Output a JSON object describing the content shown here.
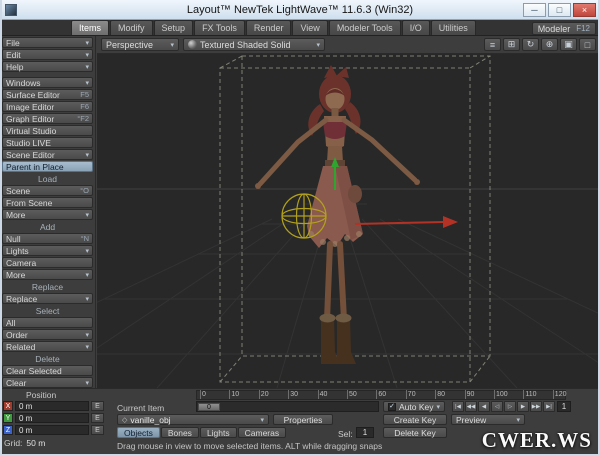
{
  "window": {
    "title": "Layout™ NewTek LightWave™ 11.6.3 (Win32)",
    "controls": [
      {
        "name": "minimize",
        "glyph": "─"
      },
      {
        "name": "maximize",
        "glyph": "□"
      },
      {
        "name": "close",
        "glyph": "×"
      }
    ]
  },
  "tabbar": {
    "tabs": [
      {
        "label": "Items",
        "active": true
      },
      {
        "label": "Modify"
      },
      {
        "label": "Setup"
      },
      {
        "label": "FX Tools"
      },
      {
        "label": "Render"
      },
      {
        "label": "View"
      },
      {
        "label": "Modeler Tools"
      },
      {
        "label": "I/O"
      },
      {
        "label": "Utilities"
      }
    ],
    "modeler_label": "Modeler",
    "modeler_hotkey": "F12"
  },
  "viewport_toolbar": {
    "view_mode": "Perspective",
    "shading_mode": "Textured Shaded Solid",
    "icons": [
      {
        "name": "menu-icon",
        "glyph": "≡"
      },
      {
        "name": "pan-icon",
        "glyph": "⊞"
      },
      {
        "name": "rotate-icon",
        "glyph": "↻"
      },
      {
        "name": "zoom-icon",
        "glyph": "⊕"
      },
      {
        "name": "fit-icon",
        "glyph": "▣"
      },
      {
        "name": "maximize-icon",
        "glyph": "□"
      }
    ]
  },
  "sidebar": {
    "items": [
      {
        "label": "File",
        "arrow": true
      },
      {
        "label": "Edit",
        "arrow": true
      },
      {
        "label": "Help",
        "arrow": true
      },
      {
        "type": "gap"
      },
      {
        "label": "Windows",
        "arrow": true
      },
      {
        "label": "Surface Editor",
        "hotkey": "F5"
      },
      {
        "label": "Image Editor",
        "hotkey": "F6"
      },
      {
        "label": "Graph Editor",
        "hotkey": "°F2"
      },
      {
        "label": "Virtual Studio"
      },
      {
        "label": "Studio LIVE"
      },
      {
        "label": "Scene Editor",
        "arrow": true
      },
      {
        "label": "Parent in Place",
        "active": true
      },
      {
        "type": "header",
        "label": "Load"
      },
      {
        "label": "Scene",
        "hotkey": "°O"
      },
      {
        "label": "From Scene"
      },
      {
        "label": "More",
        "arrow": true
      },
      {
        "type": "header",
        "label": "Add"
      },
      {
        "label": "Null",
        "hotkey": "°N"
      },
      {
        "label": "Lights",
        "arrow": true
      },
      {
        "label": "Camera"
      },
      {
        "label": "More",
        "arrow": true
      },
      {
        "type": "header",
        "label": "Replace"
      },
      {
        "label": "Replace",
        "arrow": true
      },
      {
        "type": "header",
        "label": "Select"
      },
      {
        "label": "All"
      },
      {
        "label": "Order",
        "arrow": true
      },
      {
        "label": "Related",
        "arrow": true
      },
      {
        "type": "header",
        "label": "Delete"
      },
      {
        "label": "Clear Selected"
      },
      {
        "label": "Clear",
        "arrow": true
      }
    ]
  },
  "viewport": {
    "selected_object": "vanille_obj",
    "axis_colors": {
      "x": "#b43225",
      "y": "#2fa52f",
      "z": "#3a62c8"
    },
    "wireframe_sphere_color": "#b2a11b",
    "bounding_box_color": "#98988a",
    "background_color": "#282828"
  },
  "bottom": {
    "position_label": "Position",
    "axes": [
      {
        "label": "X",
        "value": "0 m",
        "color": "#a03c2e"
      },
      {
        "label": "Y",
        "value": "0 m",
        "color": "#3f9a3f"
      },
      {
        "label": "Z",
        "value": "0 m",
        "color": "#3a62c8"
      }
    ],
    "envelope_label": "E",
    "grid_label": "Grid:",
    "grid_value": "50 m",
    "current_item_label": "Current Item",
    "current_item_icon": "◇",
    "current_item_value": "vanille_obj",
    "properties_label": "Properties",
    "item_types": [
      {
        "label": "Objects",
        "active": true
      },
      {
        "label": "Bones"
      },
      {
        "label": "Lights"
      },
      {
        "label": "Cameras"
      }
    ],
    "sel_label": "Sel:",
    "sel_value": "1",
    "auto_key_label": "Auto Key",
    "auto_key_checked": true,
    "create_key_label": "Create Key",
    "delete_key_label": "Delete Key",
    "preview_label": "Preview",
    "timeline": {
      "start": 0,
      "end": 120,
      "step": 10,
      "current": "0"
    },
    "frame_step": "1",
    "transport": [
      {
        "name": "go-start-button",
        "glyph": "|◀"
      },
      {
        "name": "prev-key-button",
        "glyph": "◀◀"
      },
      {
        "name": "prev-frame-button",
        "glyph": "◀"
      },
      {
        "name": "play-reverse-button",
        "glyph": "◁"
      },
      {
        "name": "play-forward-button",
        "glyph": "▷"
      },
      {
        "name": "next-frame-button",
        "glyph": "▶"
      },
      {
        "name": "next-key-button",
        "glyph": "▶▶"
      },
      {
        "name": "go-end-button",
        "glyph": "▶|"
      }
    ],
    "status": "Drag mouse in view to move selected items. ALT while dragging snaps",
    "watermark": "CWER.WS"
  }
}
